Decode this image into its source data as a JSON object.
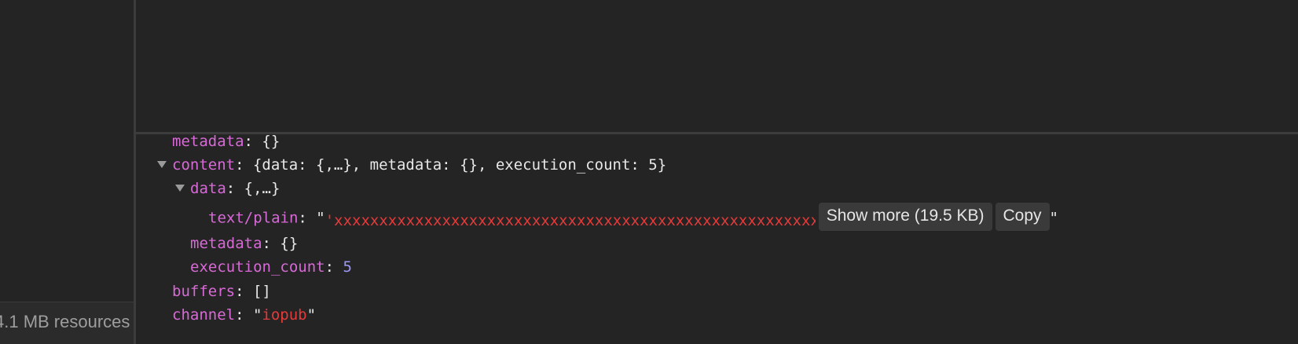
{
  "status_bar": {
    "resources_text": "4.1 MB resources"
  },
  "colors": {
    "background": "#242424",
    "key": "#d76ad6",
    "string": "#e53a3a",
    "number": "#9d98f5",
    "button_bg": "#3a3a3a"
  },
  "tree": {
    "metadata_row": {
      "key": "metadata",
      "sep": ": ",
      "value": "{}"
    },
    "content_row": {
      "key": "content",
      "sep": ": ",
      "preview": "{data: {,…}, metadata: {}, execution_count: 5}"
    },
    "data_row": {
      "key": "data",
      "sep": ": ",
      "preview": "{,…}"
    },
    "text_plain_row": {
      "key": "text/plain",
      "sep": ": ",
      "quote_open": "\"",
      "value": "'xxxxxxxxxxxxxxxxxxxxxxxxxxxxxxxxxxxxxxxxxxxxxxxxxxxxxxxxxxxxxxx",
      "show_more_label": "Show more (19.5 KB)",
      "copy_label": "Copy",
      "quote_close": "\""
    },
    "inner_metadata_row": {
      "key": "metadata",
      "sep": ": ",
      "value": "{}"
    },
    "execution_count_row": {
      "key": "execution_count",
      "sep": ": ",
      "value": "5"
    },
    "buffers_row": {
      "key": "buffers",
      "sep": ": ",
      "value": "[]"
    },
    "channel_row": {
      "key": "channel",
      "sep": ": ",
      "quote_open": "\"",
      "value": "iopub",
      "quote_close": "\""
    }
  },
  "icons": {
    "expand_arrow": "triangle-down-icon"
  }
}
